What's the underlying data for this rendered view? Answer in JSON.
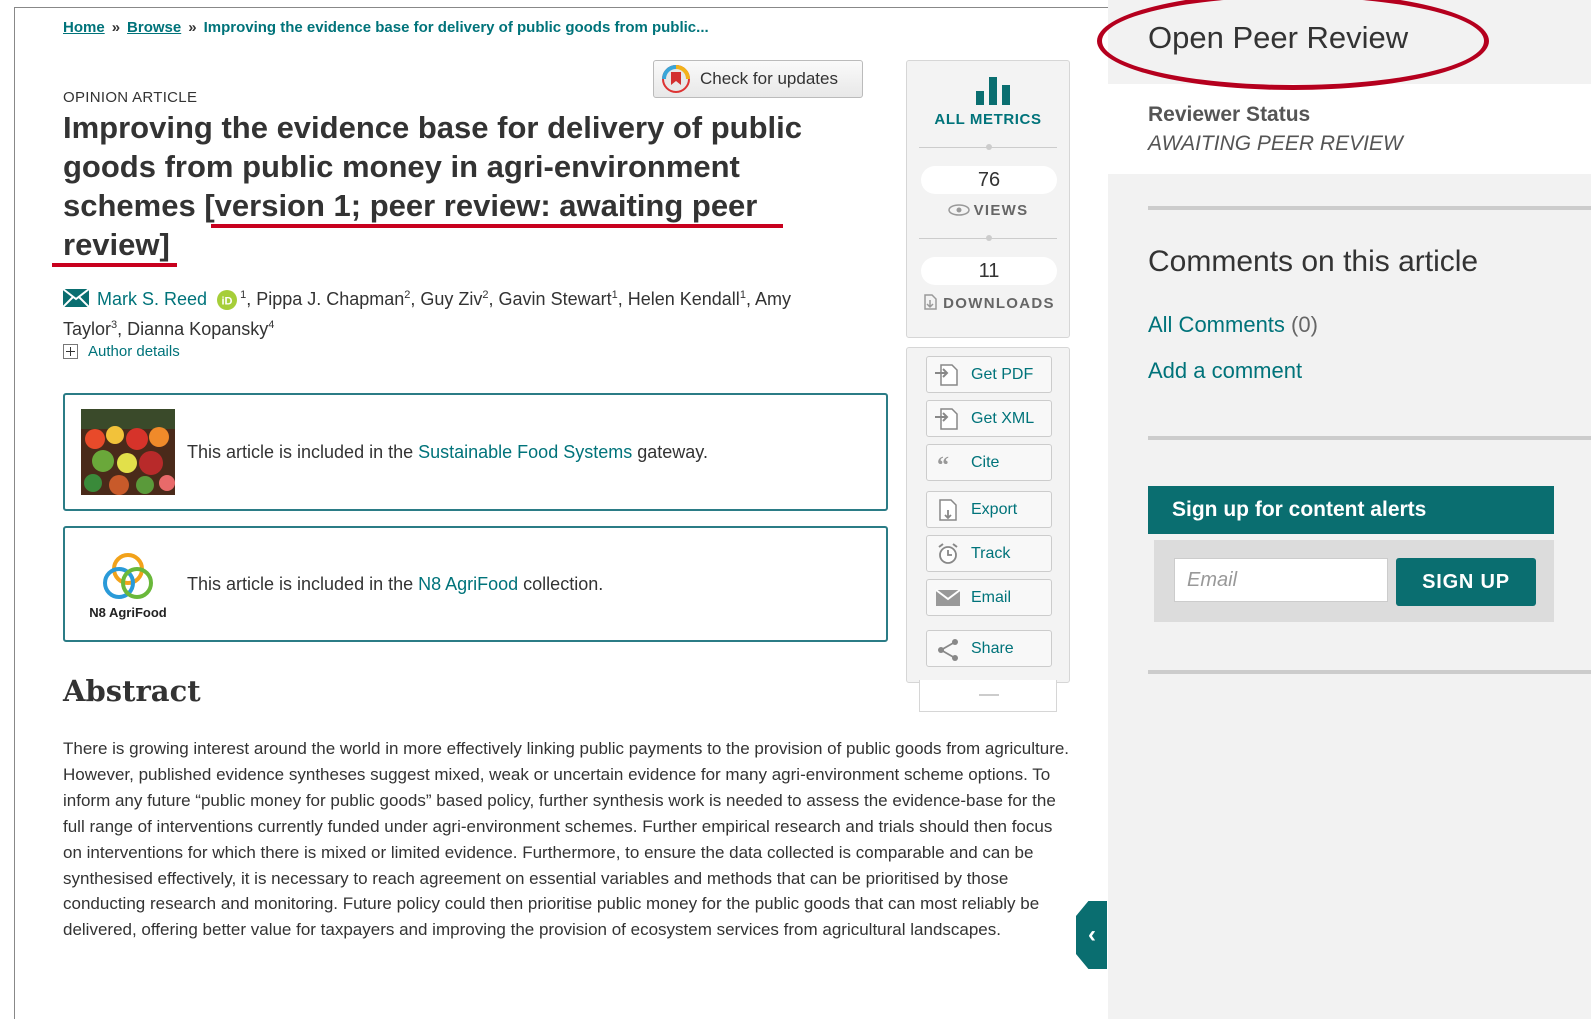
{
  "breadcrumb": {
    "home": "Home",
    "separator": "»",
    "browse": "Browse",
    "current": "Improving the evidence base for delivery of public goods from public..."
  },
  "check_updates": {
    "label": "Check for updates"
  },
  "article": {
    "type": "OPINION ARTICLE",
    "title_line1": "Improving the evidence base for delivery of public",
    "title_line2": "goods from public money in agri-environment",
    "title_line3a": "schemes ",
    "title_line3b": "[version 1; peer review: awaiting peer",
    "title_line4": "review]",
    "authors": {
      "first": "Mark S. Reed",
      "first_sup": "1",
      "rest_1": ", Pippa J. Chapman",
      "rest_1_sup": "2",
      "rest_2": ", Guy Ziv",
      "rest_2_sup": "2",
      "rest_3": ", Gavin Stewart",
      "rest_3_sup": "1",
      "rest_4": ", Helen Kendall",
      "rest_4_sup": "1",
      "rest_5": ", Amy Taylor",
      "rest_5_sup": "3",
      "rest_6": ", Dianna Kopansky",
      "rest_6_sup": "4"
    },
    "author_details": "Author details"
  },
  "gateways": [
    {
      "prefix": "This article is included in the ",
      "link": "Sustainable Food Systems",
      "suffix": " gateway."
    },
    {
      "prefix": "This article is included in the ",
      "link": "N8 AgriFood",
      "suffix": " collection.",
      "logo_text": "N8 AgriFood"
    }
  ],
  "abstract": {
    "heading": "Abstract",
    "text": "There is growing interest around the world in more effectively linking public payments to the provision of public goods from agriculture. However, published evidence syntheses suggest mixed, weak or uncertain evidence for many agri-environment scheme options. To inform any future “public money for public goods” based policy, further synthesis work is needed to assess the evidence-base for the full range of interventions currently funded under agri-environment schemes. Further empirical research and trials should then focus on interventions for which there is mixed or limited evidence. Furthermore, to ensure the data collected is comparable and can be synthesised effectively, it is necessary to reach agreement on essential variables and methods that can be prioritised by those conducting research and monitoring. Future policy could then prioritise public money for the public goods that can most reliably be delivered, offering better value for taxpayers and improving the provision of ecosystem services from agricultural landscapes."
  },
  "metrics": {
    "all_metrics": "ALL METRICS",
    "views_count": "76",
    "views_label": "VIEWS",
    "downloads_count": "11",
    "downloads_label": "DOWNLOADS"
  },
  "tools": {
    "get_pdf": "Get PDF",
    "get_xml": "Get XML",
    "cite": "Cite",
    "export": "Export",
    "track": "Track",
    "email": "Email",
    "share": "Share"
  },
  "collapse_tab": "‹",
  "right_panel": {
    "title": "Open Peer Review",
    "reviewer_status_label": "Reviewer Status",
    "reviewer_status_value": "AWAITING PEER REVIEW",
    "comments_heading": "Comments on this article",
    "all_comments": "All Comments",
    "all_comments_count": "(0)",
    "add_comment": "Add a comment",
    "alerts_title": "Sign up for content alerts",
    "email_placeholder": "Email",
    "signup_label": "SIGN UP"
  },
  "colors": {
    "teal_link": "#00737a",
    "teal_dark": "#0a6e70",
    "annotation_red": "#c8001e",
    "panel_bg": "#f2f2f2"
  }
}
